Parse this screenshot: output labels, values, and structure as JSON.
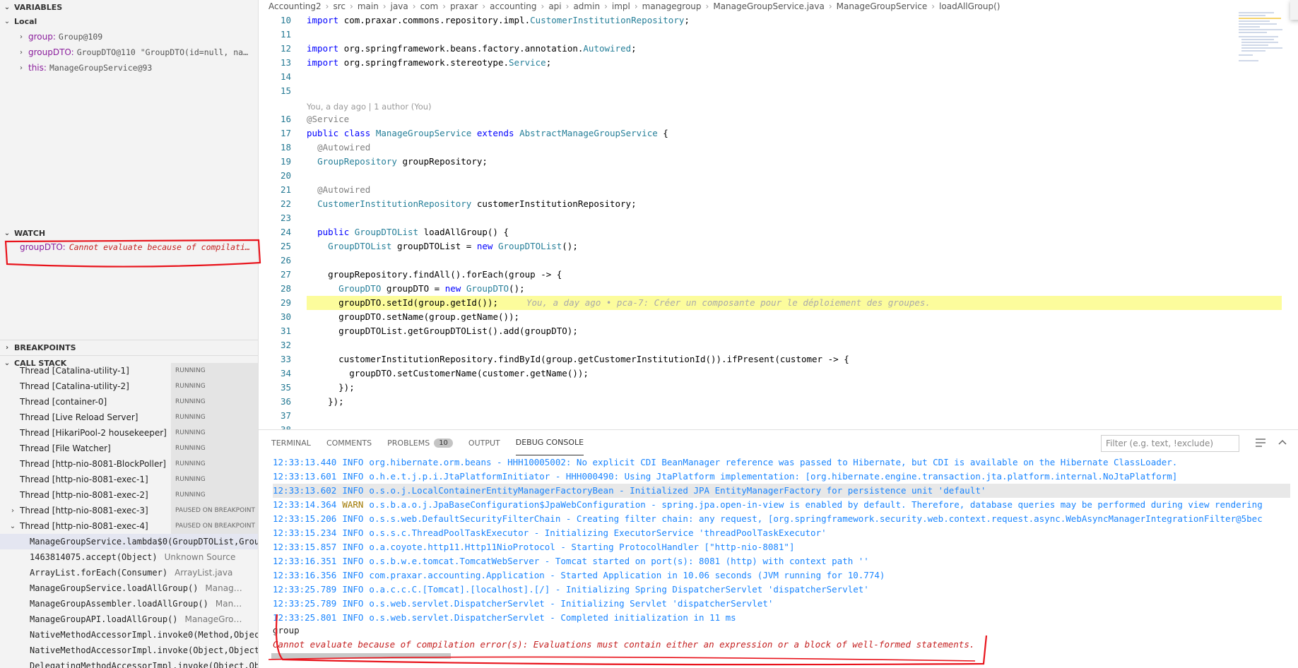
{
  "sidebar": {
    "variables": {
      "title": "VARIABLES",
      "local_label": "Local",
      "items": [
        {
          "key": "group:",
          "value": "Group@109"
        },
        {
          "key": "groupDTO:",
          "value": "GroupDTO@110 \"GroupDTO(id=null, na…"
        },
        {
          "key": "this:",
          "value": "ManageGroupService@93"
        }
      ]
    },
    "watch": {
      "title": "WATCH",
      "items": [
        {
          "key": "groupDTO:",
          "value": "Cannot evaluate because of compilati…"
        }
      ]
    },
    "breakpoints": {
      "title": "BREAKPOINTS"
    },
    "call_stack": {
      "title": "CALL STACK",
      "threads": [
        {
          "label": "Thread [Catalina-utility-1]",
          "status": "RUNNING"
        },
        {
          "label": "Thread [Catalina-utility-2]",
          "status": "RUNNING"
        },
        {
          "label": "Thread [container-0]",
          "status": "RUNNING"
        },
        {
          "label": "Thread [Live Reload Server]",
          "status": "RUNNING"
        },
        {
          "label": "Thread [HikariPool-2 housekeeper]",
          "status": "RUNNING"
        },
        {
          "label": "Thread [File Watcher]",
          "status": "RUNNING"
        },
        {
          "label": "Thread [http-nio-8081-BlockPoller]",
          "status": "RUNNING"
        },
        {
          "label": "Thread [http-nio-8081-exec-1]",
          "status": "RUNNING"
        },
        {
          "label": "Thread [http-nio-8081-exec-2]",
          "status": "RUNNING"
        },
        {
          "label": "Thread [http-nio-8081-exec-3]",
          "status": "PAUSED ON BREAKPOINT"
        },
        {
          "label": "Thread [http-nio-8081-exec-4]",
          "status": "PAUSED ON BREAKPOINT"
        }
      ],
      "frames": [
        {
          "name": "ManageGroupService.lambda$0(GroupDTOList,Grou",
          "source": ""
        },
        {
          "name": "1463814075.accept(Object)",
          "source": "Unknown Source"
        },
        {
          "name": "ArrayList.forEach(Consumer)",
          "source": "ArrayList.java"
        },
        {
          "name": "ManageGroupService.loadAllGroup()",
          "source": "Manag…"
        },
        {
          "name": "ManageGroupAssembler.loadAllGroup()",
          "source": "Man…"
        },
        {
          "name": "ManageGroupAPI.loadAllGroup()",
          "source": "ManageGro…"
        },
        {
          "name": "NativeMethodAccessorImpl.invoke0(Method,Objec",
          "source": ""
        },
        {
          "name": "NativeMethodAccessorImpl.invoke(Object,Object",
          "source": ""
        },
        {
          "name": "DelegatingMethodAccessorImpl.invoke(Object,Ob",
          "source": ""
        }
      ]
    }
  },
  "editor": {
    "breadcrumb": [
      "Accounting2",
      "src",
      "main",
      "java",
      "com",
      "praxar",
      "accounting",
      "api",
      "admin",
      "impl",
      "managegroup",
      "ManageGroupService.java",
      "ManageGroupService",
      "loadAllGroup()"
    ],
    "codelens": "You, a day ago | 1 author (You)",
    "blame": "You, a day ago • pca-7: Créer un composante pour le déploiement des groupes.",
    "lines": [
      {
        "n": "10",
        "text": "import com.praxar.commons.repository.impl.CustomerInstitutionRepository;"
      },
      {
        "n": "11",
        "text": ""
      },
      {
        "n": "12",
        "text": "import org.springframework.beans.factory.annotation.Autowired;"
      },
      {
        "n": "13",
        "text": "import org.springframework.stereotype.Service;"
      },
      {
        "n": "14",
        "text": ""
      },
      {
        "n": "15",
        "text": ""
      },
      {
        "n": "16",
        "text": "@Service"
      },
      {
        "n": "17",
        "text": "public class ManageGroupService extends AbstractManageGroupService {"
      },
      {
        "n": "18",
        "text": "  @Autowired"
      },
      {
        "n": "19",
        "text": "  GroupRepository groupRepository;"
      },
      {
        "n": "20",
        "text": ""
      },
      {
        "n": "21",
        "text": "  @Autowired"
      },
      {
        "n": "22",
        "text": "  CustomerInstitutionRepository customerInstitutionRepository;"
      },
      {
        "n": "23",
        "text": ""
      },
      {
        "n": "24",
        "text": "  public GroupDTOList loadAllGroup() {"
      },
      {
        "n": "25",
        "text": "    GroupDTOList groupDTOList = new GroupDTOList();"
      },
      {
        "n": "26",
        "text": ""
      },
      {
        "n": "27",
        "text": "    groupRepository.findAll().forEach(group -> {"
      },
      {
        "n": "28",
        "text": "      GroupDTO groupDTO = new GroupDTO();"
      },
      {
        "n": "29",
        "text": "      groupDTO.setId(group.getId());"
      },
      {
        "n": "30",
        "text": "      groupDTO.setName(group.getName());"
      },
      {
        "n": "31",
        "text": "      groupDTOList.getGroupDTOList().add(groupDTO);"
      },
      {
        "n": "32",
        "text": ""
      },
      {
        "n": "33",
        "text": "      customerInstitutionRepository.findById(group.getCustomerInstitutionId()).ifPresent(customer -> {"
      },
      {
        "n": "34",
        "text": "        groupDTO.setCustomerName(customer.getName());"
      },
      {
        "n": "35",
        "text": "      });"
      },
      {
        "n": "36",
        "text": "    });"
      },
      {
        "n": "37",
        "text": ""
      },
      {
        "n": "38",
        "text": ""
      }
    ]
  },
  "panel": {
    "tabs": [
      {
        "label": "TERMINAL"
      },
      {
        "label": "COMMENTS"
      },
      {
        "label": "PROBLEMS",
        "badge": "10"
      },
      {
        "label": "OUTPUT"
      },
      {
        "label": "DEBUG CONSOLE",
        "active": true
      }
    ],
    "filter_placeholder": "Filter (e.g. text, !exclude)",
    "log": [
      {
        "time": "12:33:13.440",
        "level": "INFO",
        "msg": "org.hibernate.orm.beans - HHH10005002: No explicit CDI BeanManager reference was passed to Hibernate, but CDI is available on the Hibernate ClassLoader."
      },
      {
        "time": "12:33:13.601",
        "level": "INFO",
        "msg": "o.h.e.t.j.p.i.JtaPlatformInitiator - HHH000490: Using JtaPlatform implementation: [org.hibernate.engine.transaction.jta.platform.internal.NoJtaPlatform]"
      },
      {
        "time": "12:33:13.602",
        "level": "INFO",
        "msg": "o.s.o.j.LocalContainerEntityManagerFactoryBean - Initialized JPA EntityManagerFactory for persistence unit 'default'"
      },
      {
        "time": "12:33:14.364",
        "level": "WARN",
        "msg": "o.s.b.a.o.j.JpaBaseConfiguration$JpaWebConfiguration - spring.jpa.open-in-view is enabled by default. Therefore, database queries may be performed during view rendering"
      },
      {
        "time": "12:33:15.206",
        "level": "INFO",
        "msg": "o.s.s.web.DefaultSecurityFilterChain - Creating filter chain: any request, [org.springframework.security.web.context.request.async.WebAsyncManagerIntegrationFilter@5bec"
      },
      {
        "time": "12:33:15.234",
        "level": "INFO",
        "msg": "o.s.s.c.ThreadPoolTaskExecutor - Initializing ExecutorService 'threadPoolTaskExecutor'"
      },
      {
        "time": "12:33:15.857",
        "level": "INFO",
        "msg": "o.a.coyote.http11.Http11NioProtocol - Starting ProtocolHandler [\"http-nio-8081\"]"
      },
      {
        "time": "12:33:16.351",
        "level": "INFO",
        "msg": "o.s.b.w.e.tomcat.TomcatWebServer - Tomcat started on port(s): 8081 (http) with context path ''"
      },
      {
        "time": "12:33:16.356",
        "level": "INFO",
        "msg": "com.praxar.accounting.Application - Started Application in 10.06 seconds (JVM running for 10.774)"
      },
      {
        "time": "12:33:25.789",
        "level": "INFO",
        "msg": "o.a.c.c.C.[Tomcat].[localhost].[/] - Initializing Spring DispatcherServlet 'dispatcherServlet'"
      },
      {
        "time": "12:33:25.789",
        "level": "INFO",
        "msg": "o.s.web.servlet.DispatcherServlet - Initializing Servlet 'dispatcherServlet'"
      },
      {
        "time": "12:33:25.801",
        "level": "INFO",
        "msg": "o.s.web.servlet.DispatcherServlet - Completed initialization in 11 ms"
      }
    ],
    "eval_input": "group",
    "eval_error": "Cannot evaluate because of compilation error(s): Evaluations must contain either an expression or a block of well-formed statements."
  }
}
